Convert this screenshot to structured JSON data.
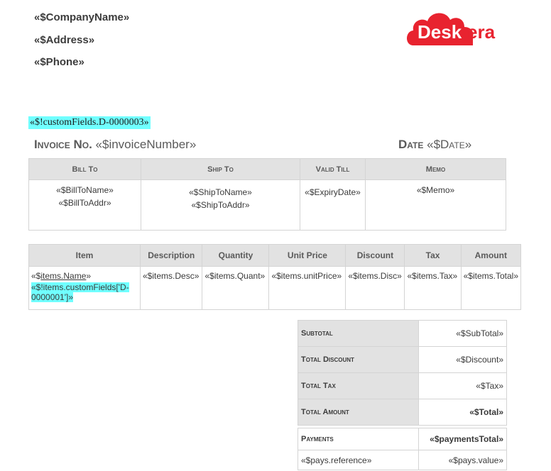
{
  "company": {
    "name": "«$CompanyName»",
    "address": "«$Address»",
    "phone": "«$Phone»"
  },
  "logo": {
    "text": "Deskera",
    "color": "#e8232f"
  },
  "custom_field": "«$!customFields.D-0000003»",
  "invoice": {
    "no_label": "Invoice No.",
    "no_value": "«$invoiceNumber»",
    "date_label": "Date",
    "date_value": "«$Date»"
  },
  "info_table": {
    "headers": [
      "Bill To",
      "Ship To",
      "Valid Till",
      "Memo"
    ],
    "bill_to": [
      "«$BillToName»",
      "«$BillToAddr»"
    ],
    "ship_to": [
      "«$ShipToName»",
      "«$ShipToAddr»"
    ],
    "valid_till": "«$ExpiryDate»",
    "memo": "«$Memo»"
  },
  "items_table": {
    "headers": [
      "Item",
      "Description",
      "Quantity",
      "Unit Price",
      "Discount",
      "Tax",
      "Amount"
    ],
    "row": {
      "item_open": "«$",
      "item_name": "items.Name",
      "item_close": "»",
      "item_custom": "«$!items.customFields['D-0000001']»",
      "desc": "«$items.Desc»",
      "qty": "«$items.Quant»",
      "unit_price": "«$items.unitPrice»",
      "discount": "«$items.Disc»",
      "tax": "«$items.Tax»",
      "amount": "«$items.Total»"
    }
  },
  "totals": [
    {
      "label": "Subtotal",
      "value": "«$SubTotal»"
    },
    {
      "label": "Total Discount",
      "value": "«$Discount»"
    },
    {
      "label": "Total Tax",
      "value": "«$Tax»"
    },
    {
      "label": "Total Amount",
      "value": "«$Total»"
    }
  ],
  "payments": {
    "label": "Payments",
    "total": "«$paymentsTotal»",
    "reference": "«$pays.reference»",
    "value": "«$pays.value»"
  },
  "colors": {
    "highlight": "#70ffff",
    "header_bg": "#e2e2e2"
  }
}
